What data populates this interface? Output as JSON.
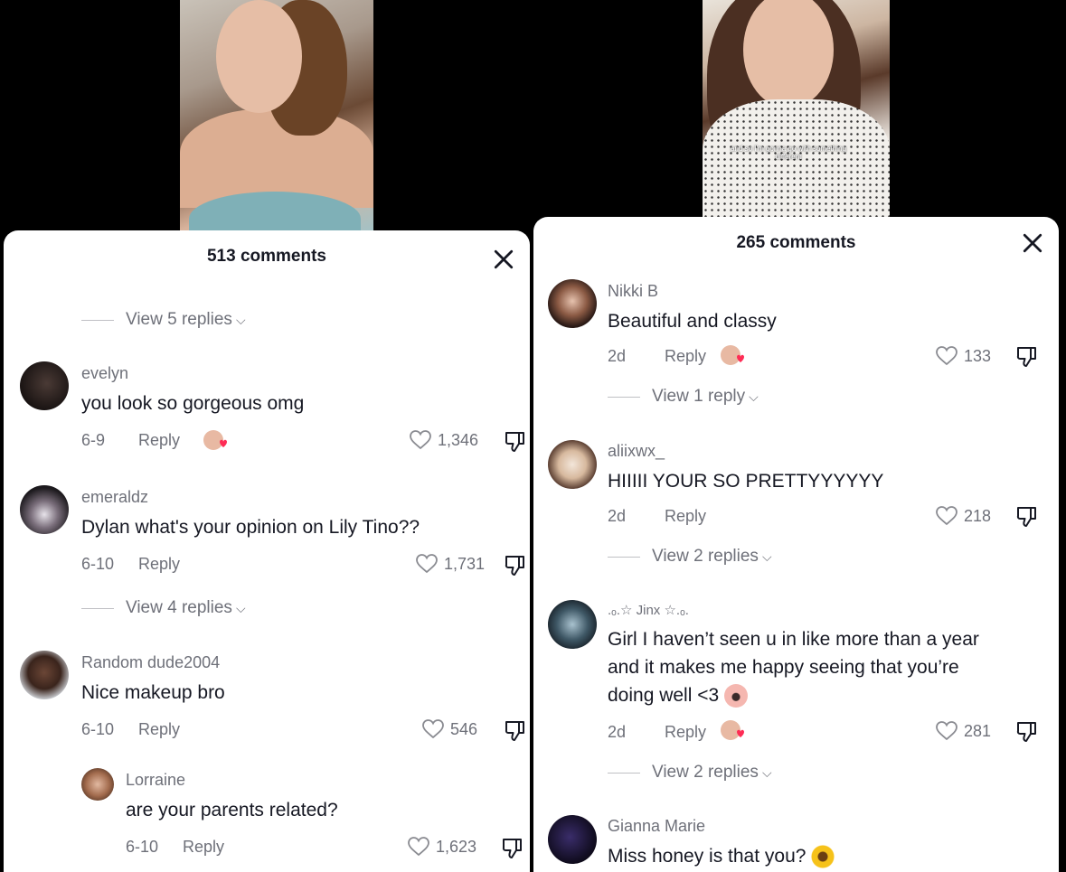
{
  "left": {
    "video_caption": "",
    "comment_count": "513 comments",
    "top_view_replies": "View 5 replies",
    "comments": [
      {
        "username": "evelyn",
        "text": "you look so gorgeous omg",
        "date": "6-9",
        "reply": "Reply",
        "likes": "1,346"
      },
      {
        "username": "emeraldz",
        "text": "Dylan what's your opinion on Lily Tino??",
        "date": "6-10",
        "reply": "Reply",
        "likes": "1,731",
        "view_replies": "View 4 replies"
      },
      {
        "username": "Random dude2004",
        "text": "Nice makeup bro",
        "date": "6-10",
        "reply": "Reply",
        "likes": "546"
      },
      {
        "username": "Lorraine",
        "text": "are your parents related?",
        "date": "6-10",
        "reply": "Reply",
        "likes": "1,623"
      }
    ]
  },
  "right": {
    "video_caption": "and so I'm gonna go with something different",
    "comment_count": "265 comments",
    "comments": [
      {
        "username": "Nikki B",
        "text": "Beautiful and classy",
        "date": "2d",
        "reply": "Reply",
        "likes": "133",
        "view_replies": "View 1 reply"
      },
      {
        "username": "aliixwx_",
        "text": "HIIIII YOUR SO PRETTYYYYYY",
        "date": "2d",
        "reply": "Reply",
        "likes": "218",
        "view_replies": "View 2 replies"
      },
      {
        "username": ".ₒ.☆ Jinx ☆.ₒ.",
        "text_line1": "Girl I haven’t seen u in like more than a year",
        "text_line2": "and it makes me happy seeing that you’re",
        "text_line3": "doing well <3",
        "date": "2d",
        "reply": "Reply",
        "likes": "281",
        "view_replies": "View 2 replies"
      },
      {
        "username": "Gianna Marie",
        "text": "Miss honey is that you?"
      }
    ]
  },
  "colors": {
    "text": "#161823",
    "muted": "#6e7079",
    "background": "#ffffff",
    "heart_badge": "#fe2c55"
  }
}
